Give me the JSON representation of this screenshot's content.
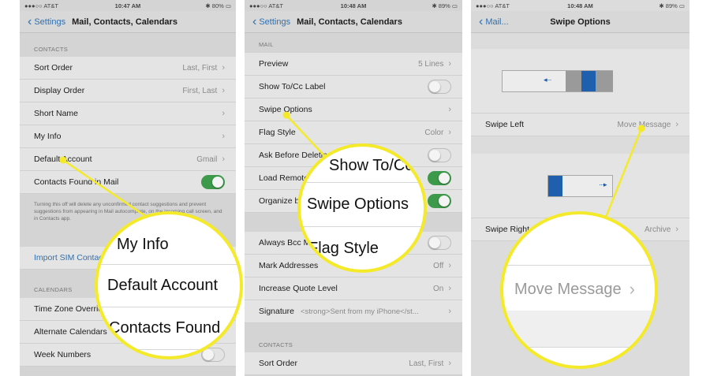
{
  "left": {
    "status": {
      "carrier": "●●●○○ AT&T",
      "time": "10:47 AM",
      "battery": "✱ 80% ▭"
    },
    "nav": {
      "back_label": "Settings",
      "title": "Mail, Contacts, Calendars"
    },
    "contacts_header": "CONTACTS",
    "rows": [
      {
        "label": "Sort Order",
        "value": "Last, First"
      },
      {
        "label": "Display Order",
        "value": "First, Last"
      },
      {
        "label": "Short Name",
        "value": ""
      },
      {
        "label": "My Info",
        "value": ""
      },
      {
        "label": "Default Account",
        "value": "Gmail"
      },
      {
        "label": "Contacts Found in Mail",
        "toggle": "on"
      }
    ],
    "footnote": "Turning this off will delete any unconfirmed contact suggestions and prevent suggestions from appearing in Mail autocomplete, on the incoming call screen, and in Contacts app.",
    "import_sim": "Import SIM Contacts",
    "calendars_header": "CALENDARS",
    "calendar_rows": [
      {
        "label": "Time Zone Override"
      },
      {
        "label": "Alternate Calendars"
      },
      {
        "label": "Week Numbers"
      }
    ],
    "magnifier": [
      "My Info",
      "Default Account",
      "Contacts Found"
    ]
  },
  "middle": {
    "status": {
      "carrier": "●●●○○ AT&T",
      "time": "10:48 AM",
      "battery": "✱ 89% ▭"
    },
    "nav": {
      "back_label": "Settings",
      "title": "Mail, Contacts, Calendars"
    },
    "mail_header": "MAIL",
    "rows": [
      {
        "label": "Preview",
        "value": "5 Lines"
      },
      {
        "label": "Show To/Cc Label",
        "toggle": "off"
      },
      {
        "label": "Swipe Options",
        "value": ""
      },
      {
        "label": "Flag Style",
        "value": "Color"
      },
      {
        "label": "Ask Before Deleting",
        "toggle": "off"
      },
      {
        "label": "Load Remote Images",
        "toggle": "on"
      },
      {
        "label": "Organize by Thread",
        "toggle": "on"
      }
    ],
    "rows2": [
      {
        "label": "Always Bcc Myself",
        "toggle": "off"
      },
      {
        "label": "Mark Addresses",
        "value": "Off"
      },
      {
        "label": "Increase Quote Level",
        "value": "On"
      },
      {
        "label": "Signature",
        "value": "<strong>Sent from my iPhone</st..."
      }
    ],
    "contacts_header": "CONTACTS",
    "rows3": [
      {
        "label": "Sort Order",
        "value": "Last, First"
      }
    ],
    "magnifier": [
      "Show To/Cc",
      "Swipe Options",
      "Flag Style"
    ]
  },
  "right": {
    "status": {
      "carrier": "●●●○○ AT&T",
      "time": "10:48 AM",
      "battery": "✱ 89% ▭"
    },
    "nav": {
      "back_label": "Mail...",
      "title": "Swipe Options"
    },
    "swipe_left": {
      "label": "Swipe Left",
      "value": "Move Message"
    },
    "swipe_right": {
      "label": "Swipe Right",
      "value": "Archive"
    },
    "magnifier": [
      "Move Message"
    ]
  },
  "colors": {
    "accent": "#2f6fb0",
    "toggle_on": "#3d9a4a",
    "callout": "#f4ea2a",
    "preview_blue": "#1e5fae"
  }
}
